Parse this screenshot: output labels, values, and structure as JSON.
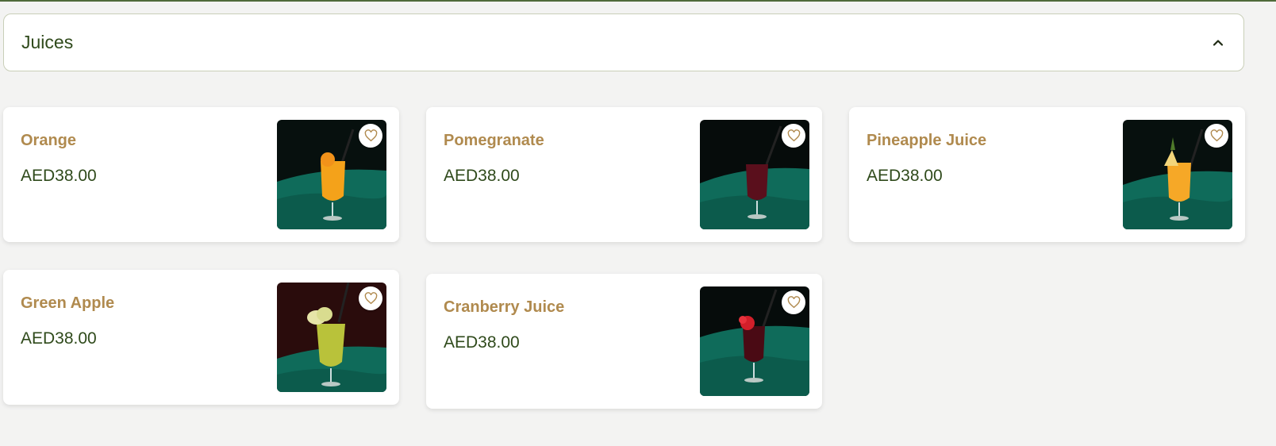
{
  "section": {
    "title": "Juices",
    "expanded": true
  },
  "colors": {
    "accent_green": "#2f4a1b",
    "name_gold": "#b08a4e",
    "heart_gold": "#b08a4e"
  },
  "products": [
    {
      "name": "Orange",
      "price": "AED38.00",
      "drink_color": "#f4a21a",
      "garnish": "orange-slice"
    },
    {
      "name": "Pomegranate",
      "price": "AED38.00",
      "drink_color": "#5a0f1c",
      "garnish": "none"
    },
    {
      "name": "Pineapple Juice",
      "price": "AED38.00",
      "drink_color": "#f6a827",
      "garnish": "pineapple-wedge"
    },
    {
      "name": "Green Apple",
      "price": "AED38.00",
      "drink_color": "#b9c23a",
      "garnish": "apple-slices"
    },
    {
      "name": "Cranberry Juice",
      "price": "AED38.00",
      "drink_color": "#4a0a14",
      "garnish": "red-flower"
    }
  ]
}
